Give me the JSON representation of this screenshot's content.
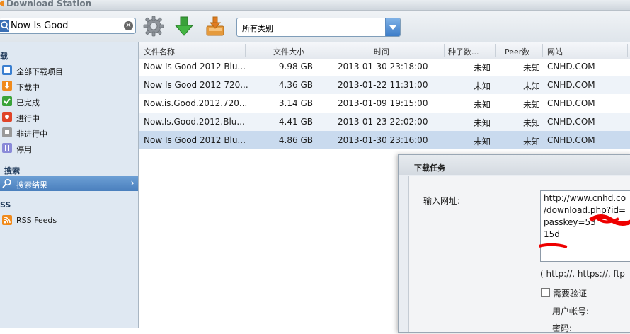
{
  "window": {
    "title": "Download Station"
  },
  "toolbar": {
    "search_value": "Now Is Good",
    "category_value": "所有类别"
  },
  "sidebar": {
    "downloads_header": "载",
    "items": [
      {
        "label": "全部下载项目",
        "icon": "list-icon",
        "color": "#3a7fd0"
      },
      {
        "label": "下载中",
        "icon": "download-icon",
        "color": "#f08a1c"
      },
      {
        "label": "已完成",
        "icon": "check-icon",
        "color": "#3aa33a"
      },
      {
        "label": "进行中",
        "icon": "active-icon",
        "color": "#e0452a"
      },
      {
        "label": "非进行中",
        "icon": "inactive-icon",
        "color": "#9a9a9a"
      },
      {
        "label": "停用",
        "icon": "pause-icon",
        "color": "#8a8ad8"
      }
    ],
    "search_header": "搜索",
    "search_results": "搜索结果",
    "rss_header": "SS",
    "rss_feeds": "RSS Feeds"
  },
  "table": {
    "headers": [
      "文件名称",
      "文件大小",
      "时间",
      "种子数...",
      "Peer数",
      "网站"
    ],
    "rows": [
      {
        "name": "Now Is Good 2012 Blu...",
        "size": "9.98 GB",
        "time": "2013-01-30 23:18:00",
        "seeds": "未知",
        "peers": "未知",
        "site": "CNHD.COM"
      },
      {
        "name": "Now Is Good 2012 720...",
        "size": "4.36 GB",
        "time": "2013-01-22 11:31:00",
        "seeds": "未知",
        "peers": "未知",
        "site": "CNHD.COM"
      },
      {
        "name": "Now.is.Good.2012.720...",
        "size": "3.14 GB",
        "time": "2013-01-09 19:15:00",
        "seeds": "未知",
        "peers": "未知",
        "site": "CNHD.COM"
      },
      {
        "name": "Now.Is.Good.2012.Blu...",
        "size": "4.41 GB",
        "time": "2013-01-23 22:02:00",
        "seeds": "未知",
        "peers": "未知",
        "site": "CNHD.COM"
      },
      {
        "name": "Now Is Good 2012 Blu...",
        "size": "4.86 GB",
        "time": "2013-01-30 23:16:00",
        "seeds": "未知",
        "peers": "未知",
        "site": "CNHD.COM"
      }
    ]
  },
  "dialog": {
    "title": "下载任务",
    "url_label": "输入网址:",
    "url_value": "http://www.cnhd.co\n/download.php?id=\npasskey=53\n15d",
    "url_hint": "( http://, https://, ftp",
    "auth_label": "需要验证",
    "user_label": "用户帐号:",
    "password_label": "密码:"
  }
}
